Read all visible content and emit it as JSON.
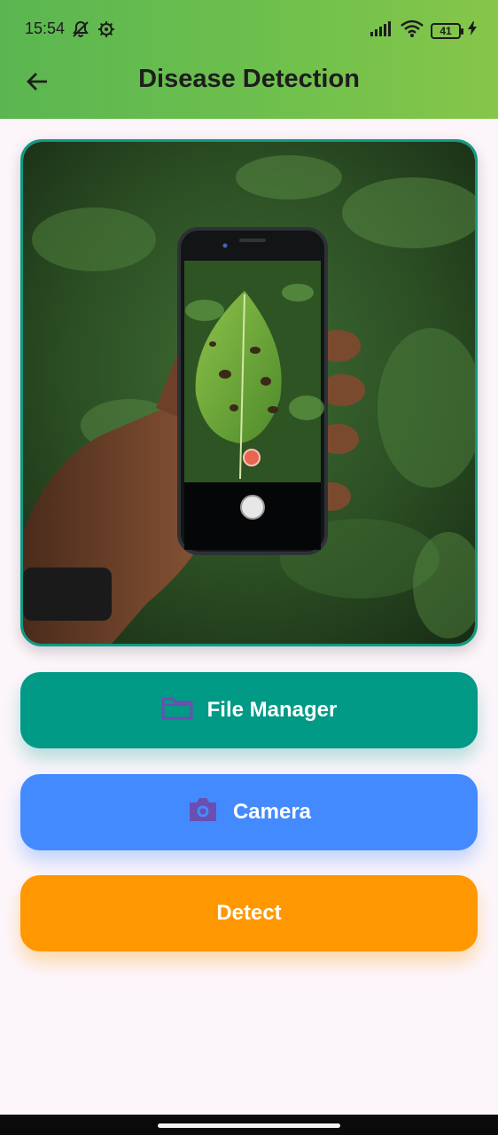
{
  "status_bar": {
    "time": "15:54",
    "battery_level": "41",
    "icons": [
      "bell-muted-icon",
      "settings-gear-icon",
      "signal-icon",
      "wifi-icon",
      "battery-icon",
      "charging-bolt-icon"
    ]
  },
  "header": {
    "title": "Disease Detection",
    "back_icon": "arrow-left-icon"
  },
  "preview": {
    "description_icon": "leaf-scan-photo"
  },
  "buttons": {
    "file_manager": {
      "label": "File Manager",
      "icon": "folder-icon"
    },
    "camera": {
      "label": "Camera",
      "icon": "camera-icon"
    },
    "detect": {
      "label": "Detect"
    }
  },
  "colors": {
    "header_start": "#5bb651",
    "header_end": "#86c64a",
    "file_button": "#009a86",
    "camera_button": "#448aff",
    "detect_button": "#ff9800",
    "icon_purple": "#6a4fb0",
    "card_border": "#0e9a84"
  }
}
